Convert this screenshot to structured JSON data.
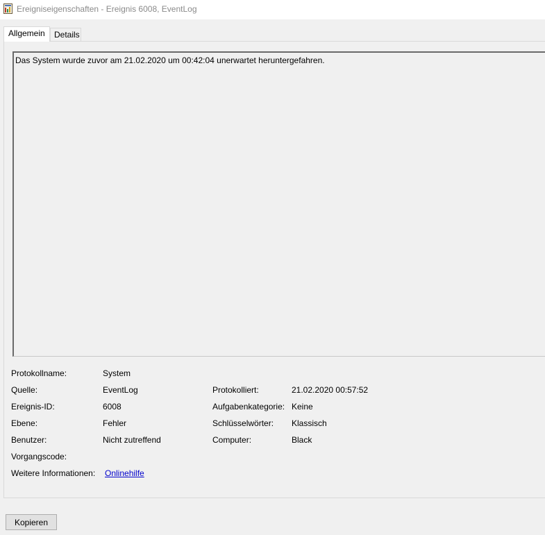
{
  "window": {
    "title": "Ereigniseigenschaften - Ereignis 6008, EventLog",
    "icon": "event-viewer-icon"
  },
  "tabs": [
    {
      "label": "Allgemein",
      "selected": true
    },
    {
      "label": "Details",
      "selected": false
    }
  ],
  "general": {
    "message": "Das System wurde zuvor am 21.02.2020 um 00:42:04 unerwartet heruntergefahren.",
    "fields": {
      "log_name": {
        "label": "Protokollname:",
        "value": "System"
      },
      "source": {
        "label": "Quelle:",
        "value": "EventLog"
      },
      "logged": {
        "label": "Protokolliert:",
        "value": "21.02.2020 00:57:52"
      },
      "event_id": {
        "label": "Ereignis-ID:",
        "value": "6008"
      },
      "task_category": {
        "label": "Aufgabenkategorie:",
        "value": "Keine"
      },
      "level": {
        "label": "Ebene:",
        "value": "Fehler"
      },
      "keywords": {
        "label": "Schlüsselwörter:",
        "value": "Klassisch"
      },
      "user": {
        "label": "Benutzer:",
        "value": "Nicht zutreffend"
      },
      "computer": {
        "label": "Computer:",
        "value": "Black"
      },
      "opcode": {
        "label": "Vorgangscode:",
        "value": ""
      },
      "more_info": {
        "label": "Weitere Informationen:",
        "link_text": "Onlinehilfe"
      }
    }
  },
  "buttons": {
    "copy_label": "Kopieren"
  },
  "colors": {
    "background": "#f0f0f0",
    "link": "#0000cc",
    "title_text": "#8a8a8a"
  }
}
